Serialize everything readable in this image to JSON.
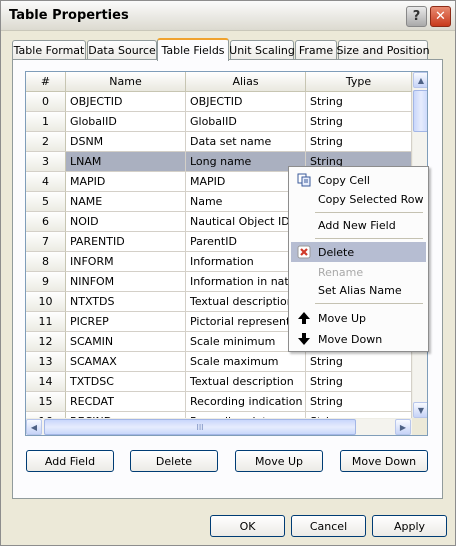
{
  "window": {
    "title": "Table Properties"
  },
  "tabs": [
    "Table Format",
    "Data Source",
    "Table Fields",
    "Unit Scaling",
    "Frame",
    "Size and Position"
  ],
  "active_tab": "Table Fields",
  "grid": {
    "columns": [
      "#",
      "Name",
      "Alias",
      "Type"
    ],
    "rows": [
      [
        "0",
        "OBJECTID",
        "OBJECTID",
        "String"
      ],
      [
        "1",
        "GlobalID",
        "GlobalID",
        "String"
      ],
      [
        "2",
        "DSNM",
        "Data set name",
        "String"
      ],
      [
        "3",
        "LNAM",
        "Long name",
        "String"
      ],
      [
        "4",
        "MAPID",
        "MAPID",
        "String"
      ],
      [
        "5",
        "NAME",
        "Name",
        "String"
      ],
      [
        "6",
        "NOID",
        "Nautical Object ID",
        "String"
      ],
      [
        "7",
        "PARENTID",
        "ParentID",
        "String"
      ],
      [
        "8",
        "INFORM",
        "Information",
        "String"
      ],
      [
        "9",
        "NINFOM",
        "Information in national",
        "String"
      ],
      [
        "10",
        "NTXTDS",
        "Textual description in",
        "String"
      ],
      [
        "11",
        "PICREP",
        "Pictorial representation",
        "String"
      ],
      [
        "12",
        "SCAMIN",
        "Scale minimum",
        "String"
      ],
      [
        "13",
        "SCAMAX",
        "Scale maximum",
        "String"
      ],
      [
        "14",
        "TXTDSC",
        "Textual description",
        "String"
      ],
      [
        "15",
        "RECDAT",
        "Recording indication",
        "String"
      ],
      [
        "16",
        "RECIND",
        "Recording date",
        "String"
      ]
    ],
    "selected_row": 3,
    "hscroll_grip": "III"
  },
  "context_menu": {
    "copy_cell": "Copy Cell",
    "copy_selected_row": "Copy Selected Row",
    "add_new_field": "Add New Field",
    "delete": "Delete",
    "rename": "Rename",
    "set_alias_name": "Set Alias Name",
    "move_up": "Move Up",
    "move_down": "Move Down"
  },
  "buttons": {
    "add_field": "Add Field",
    "delete": "Delete",
    "move_up": "Move Up",
    "move_down": "Move Down",
    "ok": "OK",
    "cancel": "Cancel",
    "apply": "Apply"
  },
  "icons": {
    "help": "?",
    "close": "✕",
    "scroll_up": "▲",
    "scroll_down": "▼",
    "scroll_left": "◀",
    "scroll_right": "▶"
  },
  "colors": {
    "accent_tab": "#f0a22c",
    "selection": "#aab0c0",
    "menu_highlight": "#b6bdd2",
    "close_button": "#c8391c",
    "delete_icon": "#d03a2a"
  }
}
